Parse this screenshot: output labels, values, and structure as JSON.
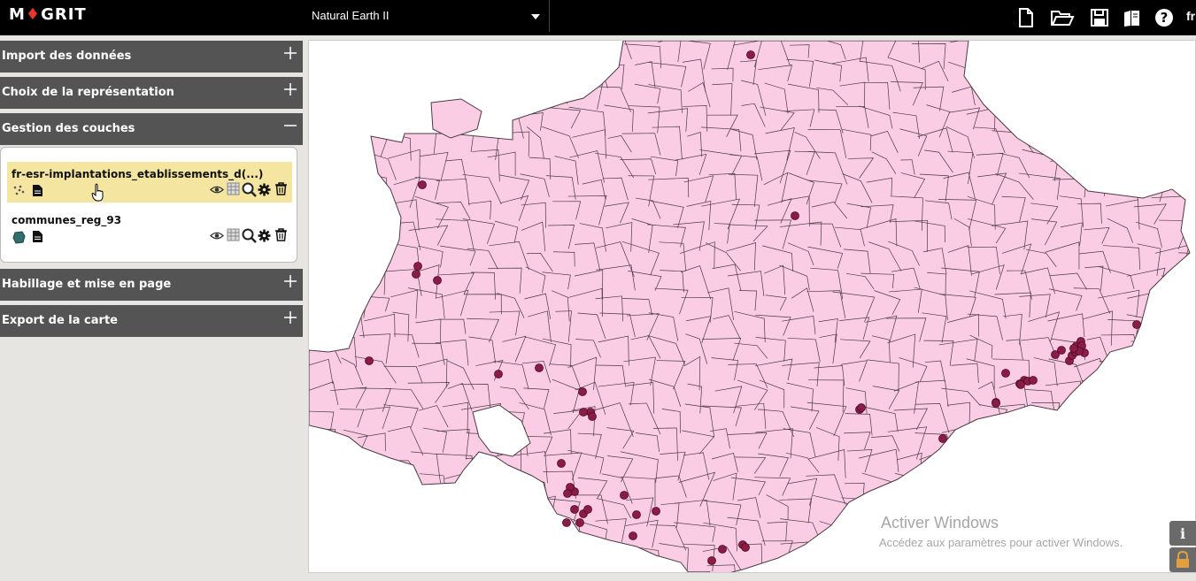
{
  "app": {
    "logo_text": "MGRIT",
    "logo_pin": "♦"
  },
  "projection": {
    "selected": "Natural Earth II"
  },
  "toolbar": {
    "icons": [
      "new-file-icon",
      "open-folder-icon",
      "save-icon",
      "book-icon",
      "help-icon"
    ],
    "language": "fr"
  },
  "panels": {
    "import": {
      "title": "Import des données",
      "toggle": "+"
    },
    "representation": {
      "title": "Choix de la représentation",
      "toggle": "+"
    },
    "layers": {
      "title": "Gestion des couches",
      "toggle": "−"
    },
    "layout": {
      "title": "Habillage et mise en page",
      "toggle": "+"
    },
    "export": {
      "title": "Export de la carte",
      "toggle": "+"
    }
  },
  "layers": [
    {
      "name": "fr-esr-implantations_etablissements_d(...)",
      "type": "point",
      "selected": true
    },
    {
      "name": "communes_reg_93",
      "type": "polygon",
      "selected": false
    }
  ],
  "map": {
    "fill_color": "#fbcde4",
    "stroke_color": "#4a3a45",
    "point_color": "#8b1c45"
  },
  "watermark": {
    "line1": "Activer Windows",
    "line2": "Accédez aux paramètres pour activer Windows."
  },
  "side_buttons": [
    "info-icon",
    "lock-icon"
  ]
}
